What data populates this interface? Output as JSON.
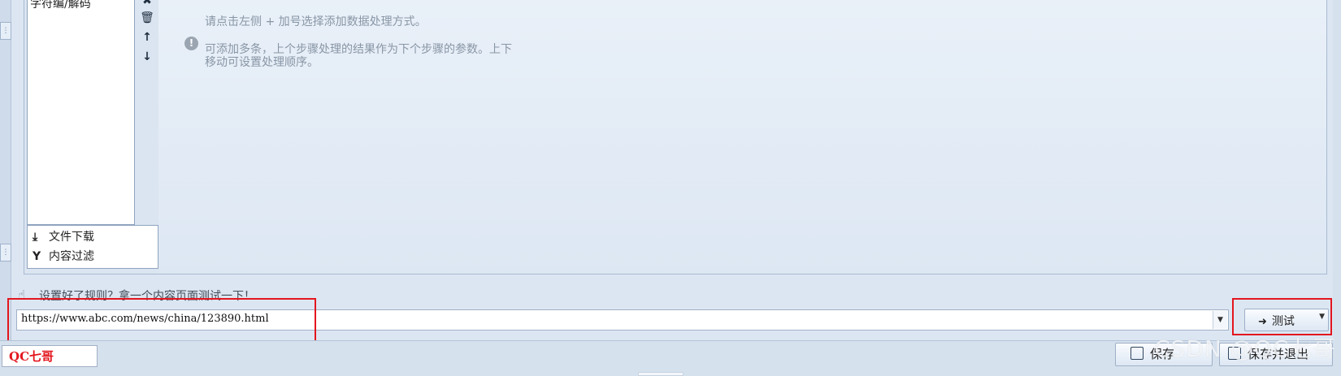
{
  "rule_list": {
    "items": [
      "字符编/解码"
    ]
  },
  "toolbar": {
    "icons": [
      "close-icon",
      "trash-icon",
      "arrow-up-icon",
      "arrow-down-icon"
    ],
    "glyphs": {
      "close": "✖",
      "trash": "🗑",
      "up": "↑",
      "down": "↓"
    }
  },
  "processing_types": [
    {
      "label": "文件下载",
      "icon": "download-icon",
      "glyph": "⤓"
    },
    {
      "label": "内容过滤",
      "icon": "filter-icon",
      "glyph": "Y"
    }
  ],
  "hints": {
    "line1": "请点击左侧 + 加号选择添加数据处理方式。",
    "line2": "可添加多条，上个步骤处理的结果作为下个步骤的参数。上下移动可设置处理顺序。"
  },
  "test_section": {
    "prompt": "设置好了规则？拿一个内容页面测试一下！",
    "url_value": "https://www.abc.com/news/china/123890.html",
    "test_button_label": "测试"
  },
  "footer": {
    "logo_text": "QC七哥",
    "save_label": "保存",
    "save_exit_label": "保存并退出",
    "watermark": "CSDN @QC七哥"
  },
  "colors": {
    "highlight": "#e3161e",
    "background": "#dce6f2"
  }
}
